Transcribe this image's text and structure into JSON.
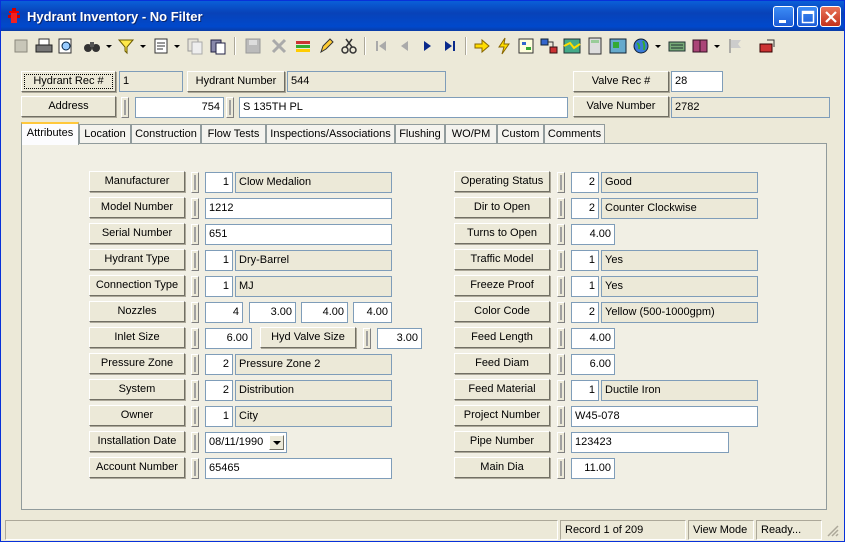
{
  "window": {
    "title": "Hydrant Inventory - No Filter"
  },
  "toolbar": {
    "icons": [
      "new-icon",
      "print-icon",
      "preview-icon",
      "binoculars-icon",
      "filter-icon",
      "report-icon",
      "copy-icon",
      "paste-icon",
      "save-icon",
      "delete-icon",
      "books-icon",
      "edit-pencil-icon",
      "cut-icon",
      "first-record-icon",
      "prev-record-icon",
      "next-record-icon",
      "last-record-icon",
      "goto-icon",
      "lightning-icon",
      "tree-icon",
      "relate-icon",
      "map-icon",
      "calculator-icon",
      "gis-icon",
      "globe-icon",
      "keyboard-icon",
      "book-icon",
      "flag-icon",
      "exit-icon"
    ]
  },
  "header": {
    "hydrant_rec_label": "Hydrant Rec #",
    "hydrant_rec_value": "1",
    "hydrant_number_label": "Hydrant Number",
    "hydrant_number_value": "544",
    "valve_rec_label": "Valve Rec #",
    "valve_rec_value": "28",
    "address_label": "Address",
    "address_number": "754",
    "address_street": "S 135TH PL",
    "valve_number_label": "Valve Number",
    "valve_number_value": "2782"
  },
  "tabs": [
    "Attributes",
    "Location",
    "Construction",
    "Flow Tests",
    "Inspections/Associations",
    "Flushing",
    "WO/PM",
    "Custom",
    "Comments"
  ],
  "attributes": {
    "manufacturer": {
      "label": "Manufacturer",
      "code": "1",
      "value": "Clow Medalion"
    },
    "model_number": {
      "label": "Model Number",
      "value": "1212"
    },
    "serial_number": {
      "label": "Serial Number",
      "value": "651"
    },
    "hydrant_type": {
      "label": "Hydrant Type",
      "code": "1",
      "value": "Dry-Barrel"
    },
    "connection_type": {
      "label": "Connection Type",
      "code": "1",
      "value": "MJ"
    },
    "nozzles": {
      "label": "Nozzles",
      "count": "4",
      "size1": "3.00",
      "size2": "4.00",
      "size3": "4.00"
    },
    "inlet_size": {
      "label": "Inlet Size",
      "value": "6.00"
    },
    "hyd_valve_size": {
      "label": "Hyd Valve Size",
      "value": "3.00"
    },
    "pressure_zone": {
      "label": "Pressure Zone",
      "code": "2",
      "value": "Pressure Zone 2"
    },
    "system": {
      "label": "System",
      "code": "2",
      "value": "Distribution"
    },
    "owner": {
      "label": "Owner",
      "code": "1",
      "value": "City"
    },
    "installation_date": {
      "label": "Installation Date",
      "value": "08/11/1990"
    },
    "account_number": {
      "label": "Account Number",
      "value": "65465"
    },
    "operating_status": {
      "label": "Operating Status",
      "code": "2",
      "value": "Good"
    },
    "dir_to_open": {
      "label": "Dir to Open",
      "code": "2",
      "value": "Counter Clockwise"
    },
    "turns_to_open": {
      "label": "Turns to Open",
      "value": "4.00"
    },
    "traffic_model": {
      "label": "Traffic Model",
      "code": "1",
      "value": "Yes"
    },
    "freeze_proof": {
      "label": "Freeze Proof",
      "code": "1",
      "value": "Yes"
    },
    "color_code": {
      "label": "Color Code",
      "code": "2",
      "value": "Yellow (500-1000gpm)"
    },
    "feed_length": {
      "label": "Feed Length",
      "value": "4.00"
    },
    "feed_diam": {
      "label": "Feed Diam",
      "value": "6.00"
    },
    "feed_material": {
      "label": "Feed Material",
      "code": "1",
      "value": "Ductile Iron"
    },
    "project_number": {
      "label": "Project Number",
      "value": "W45-078"
    },
    "pipe_number": {
      "label": "Pipe Number",
      "value": "123423"
    },
    "main_dia": {
      "label": "Main Dia",
      "value": "11.00"
    }
  },
  "status": {
    "record": "Record 1 of 209",
    "mode": "View Mode",
    "state": "Ready..."
  },
  "colors": {
    "titlebar": "#0842B8",
    "tab_highlight": "#FFC83C",
    "field_border": "#7F9DB9"
  }
}
